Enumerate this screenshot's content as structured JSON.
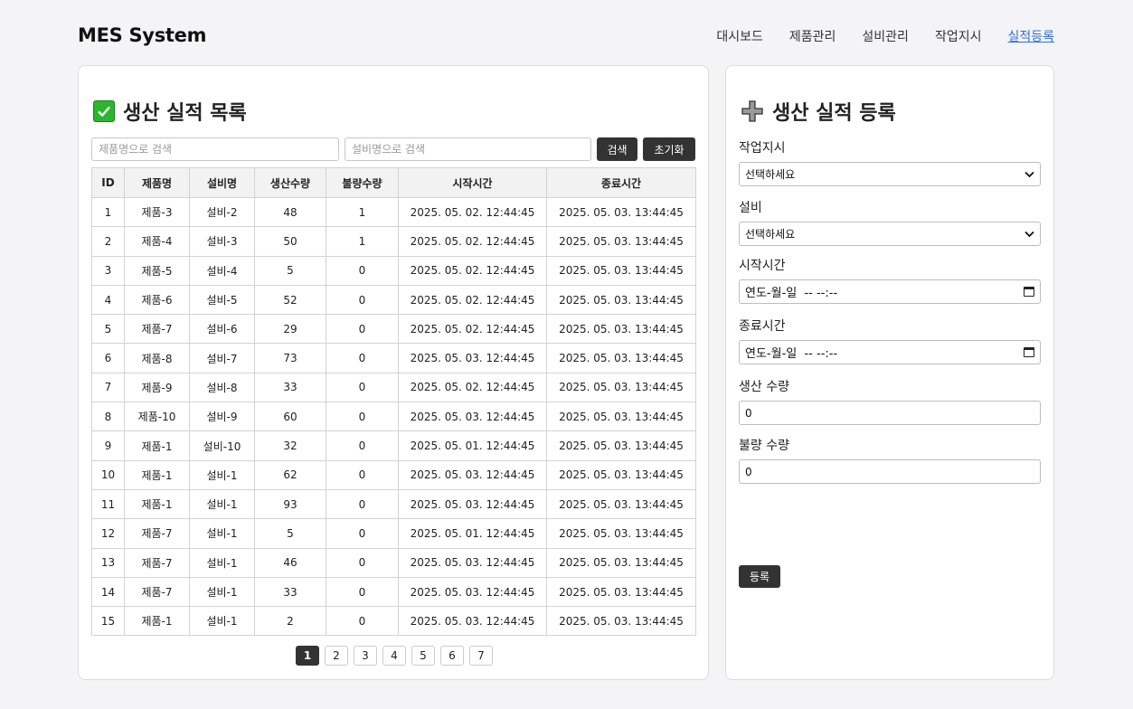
{
  "header": {
    "logo": "MES System",
    "nav": [
      "대시보드",
      "제품관리",
      "설비관리",
      "작업지시",
      "실적등록"
    ],
    "active_index": 4
  },
  "list_section": {
    "title": "생산 실적 목록",
    "search_product_placeholder": "제품명으로 검색",
    "search_equipment_placeholder": "설비명으로 검색",
    "search_button": "검색",
    "reset_button": "초기화",
    "columns": [
      "ID",
      "제품명",
      "설비명",
      "생산수량",
      "불량수량",
      "시작시간",
      "종료시간"
    ],
    "rows": [
      [
        "1",
        "제품-3",
        "설비-2",
        "48",
        "1",
        "2025. 05. 02. 12:44:45",
        "2025. 05. 03. 13:44:45"
      ],
      [
        "2",
        "제품-4",
        "설비-3",
        "50",
        "1",
        "2025. 05. 02. 12:44:45",
        "2025. 05. 03. 13:44:45"
      ],
      [
        "3",
        "제품-5",
        "설비-4",
        "5",
        "0",
        "2025. 05. 02. 12:44:45",
        "2025. 05. 03. 13:44:45"
      ],
      [
        "4",
        "제품-6",
        "설비-5",
        "52",
        "0",
        "2025. 05. 02. 12:44:45",
        "2025. 05. 03. 13:44:45"
      ],
      [
        "5",
        "제품-7",
        "설비-6",
        "29",
        "0",
        "2025. 05. 02. 12:44:45",
        "2025. 05. 03. 13:44:45"
      ],
      [
        "6",
        "제품-8",
        "설비-7",
        "73",
        "0",
        "2025. 05. 03. 12:44:45",
        "2025. 05. 03. 13:44:45"
      ],
      [
        "7",
        "제품-9",
        "설비-8",
        "33",
        "0",
        "2025. 05. 02. 12:44:45",
        "2025. 05. 03. 13:44:45"
      ],
      [
        "8",
        "제품-10",
        "설비-9",
        "60",
        "0",
        "2025. 05. 03. 12:44:45",
        "2025. 05. 03. 13:44:45"
      ],
      [
        "9",
        "제품-1",
        "설비-10",
        "32",
        "0",
        "2025. 05. 01. 12:44:45",
        "2025. 05. 03. 13:44:45"
      ],
      [
        "10",
        "제품-1",
        "설비-1",
        "62",
        "0",
        "2025. 05. 03. 12:44:45",
        "2025. 05. 03. 13:44:45"
      ],
      [
        "11",
        "제품-1",
        "설비-1",
        "93",
        "0",
        "2025. 05. 03. 12:44:45",
        "2025. 05. 03. 13:44:45"
      ],
      [
        "12",
        "제품-7",
        "설비-1",
        "5",
        "0",
        "2025. 05. 01. 12:44:45",
        "2025. 05. 03. 13:44:45"
      ],
      [
        "13",
        "제품-7",
        "설비-1",
        "46",
        "0",
        "2025. 05. 03. 12:44:45",
        "2025. 05. 03. 13:44:45"
      ],
      [
        "14",
        "제품-7",
        "설비-1",
        "33",
        "0",
        "2025. 05. 03. 12:44:45",
        "2025. 05. 03. 13:44:45"
      ],
      [
        "15",
        "제품-1",
        "설비-1",
        "2",
        "0",
        "2025. 05. 03. 12:44:45",
        "2025. 05. 03. 13:44:45"
      ]
    ],
    "pages": [
      "1",
      "2",
      "3",
      "4",
      "5",
      "6",
      "7"
    ],
    "current_page": "1"
  },
  "form_section": {
    "title": "생산 실적 등록",
    "work_order_label": "작업지시",
    "work_order_value": "선택하세요",
    "equipment_label": "설비",
    "equipment_value": "선택하세요",
    "start_label": "시작시간",
    "start_value": "연도-월-일  -- --:--",
    "end_label": "종료시간",
    "end_value": "연도-월-일  -- --:--",
    "qty_label": "생산 수량",
    "qty_value": "0",
    "defect_label": "불량 수량",
    "defect_value": "0",
    "submit_button": "등록"
  },
  "colors": {
    "accent_link": "#2f6fd6",
    "dark_button": "#333333",
    "check_green": "#2db52d"
  }
}
